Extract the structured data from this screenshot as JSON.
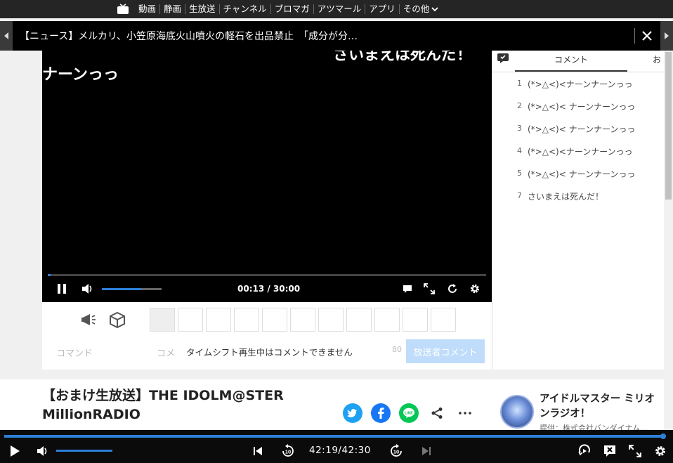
{
  "topnav": {
    "items": [
      "動画",
      "静画",
      "生放送",
      "チャンネル",
      "ブロマガ",
      "アツマール",
      "アプリ"
    ],
    "more_label": "その他"
  },
  "newsbar": {
    "text": "【ニュース】メルカリ、小笠原海底火山噴火の軽石を出品禁止　「成分が分…"
  },
  "player": {
    "flow_comments": [
      "ナーンっっ",
      "さいまえは死んだ！"
    ],
    "time": "00:13 / 30:00",
    "seek_fraction": 0.007,
    "volume_fraction": 0.66
  },
  "comment_panel": {
    "tab_comment": "コメント",
    "tab_other": "お",
    "comments": [
      {
        "no": "1",
        "text": "(*>△<)<ナーンナーンっっ"
      },
      {
        "no": "2",
        "text": "(*>△<)< ナーンナーンっっ"
      },
      {
        "no": "3",
        "text": "(*>△<)< ナーンナーンっっ"
      },
      {
        "no": "4",
        "text": "(*>△<)<ナーンナーンっっ"
      },
      {
        "no": "5",
        "text": "(*>△<)< ナーンナーンっっ"
      },
      {
        "no": "7",
        "text": "さいまえは死んだ！"
      }
    ]
  },
  "input_area": {
    "command_placeholder": "コマンド",
    "comment_placeholder": "コメ",
    "timeshift_message": "タイムシフト再生中はコメントできません",
    "char_count": "80",
    "broadcaster_button": "放送者コメント"
  },
  "info": {
    "title": "【おまけ生放送】THE IDOLM@STER MillionRADIO",
    "channel_name": "アイドルマスター ミリオンラジオ！",
    "channel_provider": "提供：株式会社バンダイナム…"
  },
  "bottom_bar": {
    "time": "42:19/42:30",
    "seek_fraction": 0.996
  },
  "colors": {
    "accent": "#2d7fd8",
    "twitter": "#1da1f2",
    "facebook": "#1877f2",
    "line": "#06c755"
  }
}
